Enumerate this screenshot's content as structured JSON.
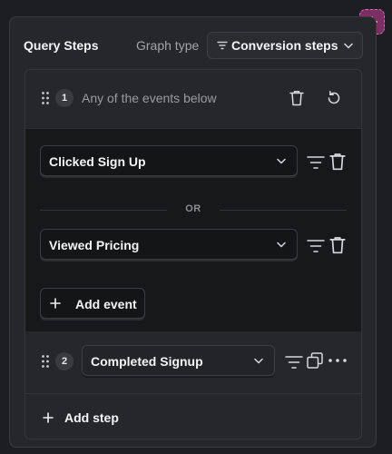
{
  "header": {
    "title": "Query Steps",
    "graph_type_label": "Graph type",
    "graph_type_value": "Conversion steps"
  },
  "steps": [
    {
      "number": "1",
      "label": "Any of the events below",
      "events": [
        {
          "name": "Clicked Sign Up"
        },
        {
          "name": "Viewed Pricing"
        }
      ],
      "separator": "OR",
      "add_event_label": "Add event"
    },
    {
      "number": "2",
      "event": "Completed Signup"
    }
  ],
  "add_step_label": "Add step",
  "colors": {
    "accent": "#7c2f63",
    "accent_border": "#d66bb4",
    "panel_bg": "#26272b",
    "events_bg": "#17181a"
  },
  "icons": [
    "plus-icon",
    "filter-icon",
    "chevron-down-icon",
    "drag-handle-icon",
    "trash-icon",
    "reset-icon",
    "duplicate-icon",
    "more-icon"
  ]
}
